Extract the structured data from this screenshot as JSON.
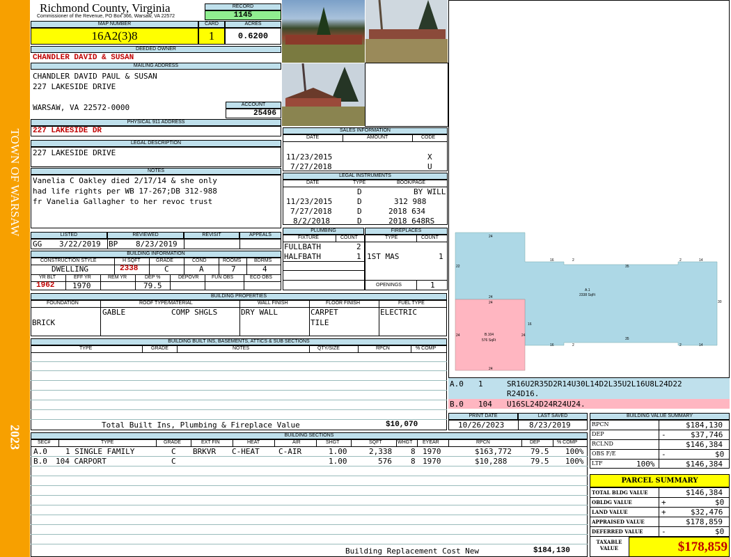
{
  "side": {
    "town": "TOWN OF WARSAW",
    "year": "2023"
  },
  "header": {
    "county": "Richmond County, Virginia",
    "commissioner": "Commissioner of the Revenue, PO Box 366, Warsaw, VA 22572",
    "record_label": "RECORD",
    "record": "1145",
    "map_label": "MAP NUMBER",
    "map": "16A2(3)8",
    "card_label": "CARD",
    "card": "1",
    "acres_label": "ACRES",
    "acres": "0.6200"
  },
  "owner": {
    "deeded_label": "DEEDED OWNER",
    "deeded": "CHANDLER DAVID & SUSAN",
    "mailing_label": "MAILING ADDRESS",
    "line1": "CHANDLER DAVID PAUL & SUSAN",
    "line2": "227 LAKESIDE DRIVE",
    "line3": "WARSAW, VA 22572-0000",
    "account_label": "ACCOUNT",
    "account": "25496"
  },
  "physical": {
    "label": "PHYSICAL 911 ADDRESS",
    "value": "227 LAKESIDE DR"
  },
  "legal": {
    "label": "LEGAL DESCRIPTION",
    "value": "227 LAKESIDE DRIVE"
  },
  "notes": {
    "label": "NOTES",
    "lines": [
      "Vanelia C Oakley died 2/17/14 & she only",
      "had life rights per WB 17-267;DB 312-988",
      "fr Vanelia Gallagher to her revoc trust"
    ]
  },
  "sales": {
    "label": "SALES INFORMATION",
    "cols": [
      "DATE",
      "AMOUNT",
      "CODE"
    ],
    "rows": [
      {
        "date": "11/23/2015",
        "code": "X"
      },
      {
        "date": "7/27/2018",
        "code": "U"
      }
    ]
  },
  "instruments": {
    "label": "LEGAL INSTRUMENTS",
    "cols": [
      "DATE",
      "TYPE",
      "BOOK/PAGE"
    ],
    "rows": [
      {
        "date": "",
        "type": "D",
        "book": "BY WILL"
      },
      {
        "date": "11/23/2015",
        "type": "D",
        "book": "312 988"
      },
      {
        "date": "7/27/2018",
        "type": "D",
        "book": "2018 634"
      },
      {
        "date": "8/2/2018",
        "type": "D",
        "book": "2018 648RS"
      }
    ]
  },
  "review": {
    "cols": [
      "LISTED",
      "REVIEWED",
      "REVISIT",
      "APPEALS"
    ],
    "listed_by": "GG",
    "listed": "3/22/2019",
    "reviewed_by": "BP",
    "reviewed": "8/23/2019"
  },
  "building": {
    "label": "BUILDING INFORMATION",
    "cols": [
      "CONSTRUCTION STYLE",
      "H SQFT",
      "GRADE",
      "COND",
      "ROOMS",
      "BDRMS"
    ],
    "style": "DWELLING",
    "sqft": "2338",
    "grade": "C",
    "cond": "A",
    "rooms": "7",
    "bdrms": "4",
    "cols2": [
      "YR BLT",
      "EFF YR",
      "REM YR",
      "DEP %",
      "DEPOVR",
      "FUN OBS",
      "ECO OBS"
    ],
    "yr": "1962",
    "eff": "1970",
    "dep": "79.5"
  },
  "plumbing": {
    "label": "PLUMBING",
    "cols": [
      "FIXTURE",
      "COUNT"
    ],
    "rows": [
      {
        "f": "FULLBATH",
        "c": "2"
      },
      {
        "f": "HALFBATH",
        "c": "1"
      }
    ]
  },
  "fireplaces": {
    "label": "FIREPLACES",
    "cols": [
      "TYPE",
      "COUNT"
    ],
    "rows": [
      {
        "t": "1ST MAS",
        "c": "1"
      }
    ],
    "openings_label": "OPENINGS",
    "openings": "1"
  },
  "properties": {
    "label": "BUILDING PROPERTIES",
    "cols": [
      "FOUNDATION",
      "ROOF TYPE/MATERIAL",
      "WALL FINISH",
      "FLOOR FINISH",
      "FUEL TYPE"
    ],
    "foundation": "BRICK",
    "roof1": "GABLE",
    "roof2": "COMP SHGLS",
    "wall": "DRY WALL",
    "floor1": "CARPET",
    "floor2": "TILE",
    "fuel": "ELECTRIC"
  },
  "builtins": {
    "label": "BUILDING BUILT INS, BASEMENTS, ATTICS & SUB SECTIONS",
    "cols": [
      "TYPE",
      "GRADE",
      "NOTES",
      "QTY/SIZE",
      "RPCN",
      "% COMP"
    ],
    "total_label": "Total Built Ins, Plumbing & Fireplace Value",
    "total": "$10,070"
  },
  "sketch": {
    "area_a": "2338 SqFt",
    "area_b": "576 SqFt",
    "label_a": "A.1",
    "label_b": "B.104",
    "d24": "24",
    "d16": "16",
    "d2": "2",
    "d35": "35",
    "d14": "14",
    "d22": "22",
    "d30": "30",
    "rows": [
      {
        "code": "A.0",
        "n": "1",
        "desc": "SR16U2R35D2R14U30L14D2L35U2L16U8L24D22",
        "desc2": "R24D16."
      },
      {
        "code": "B.0",
        "n": "104",
        "desc": "U16SL24D24R24U24."
      }
    ]
  },
  "dates": {
    "print_label": "PRINT DATE",
    "print": "10/26/2023",
    "saved_label": "LAST SAVED",
    "saved": "8/23/2019"
  },
  "sections": {
    "label": "BUILDING SECTIONS",
    "cols": [
      "SEC#",
      "TYPE",
      "GRADE",
      "EXT FIN",
      "HEAT",
      "AIR",
      "SHGT",
      "SQFT",
      "WHGT",
      "EYEAR",
      "RPCN",
      "DEP",
      "% COMP"
    ],
    "rows": [
      {
        "sec": "A.0",
        "type": "1 SINGLE FAMILY",
        "grade": "C",
        "ext": "BRKVR",
        "heat": "C-HEAT",
        "air": "C-AIR",
        "shgt": "1.00",
        "sqft": "2,338",
        "whgt": "8",
        "eyear": "1970",
        "rpcn": "$163,772",
        "dep": "79.5",
        "comp": "100%"
      },
      {
        "sec": "B.0",
        "type": "104 CARPORT",
        "grade": "C",
        "ext": "",
        "heat": "",
        "air": "",
        "shgt": "1.00",
        "sqft": "576",
        "whgt": "8",
        "eyear": "1970",
        "rpcn": "$10,288",
        "dep": "79.5",
        "comp": "100%"
      }
    ],
    "total_label": "Building Replacement Cost New",
    "total": "$184,130"
  },
  "bvs": {
    "label": "BUILDING VALUE SUMMARY",
    "rows": [
      {
        "l": "RPCN",
        "s": "",
        "v": "$184,130"
      },
      {
        "l": "DEP",
        "s": "-",
        "v": "$37,746"
      },
      {
        "l": "RCLND",
        "s": "",
        "v": "$146,384"
      },
      {
        "l": "OBS F/E",
        "s": "-",
        "v": "$0"
      },
      {
        "l": "LTF",
        "s": "100%",
        "v": "$146,384"
      }
    ]
  },
  "parcel": {
    "label": "PARCEL SUMMARY",
    "rows": [
      {
        "l": "TOTAL BLDG VALUE",
        "s": "",
        "v": "$146,384"
      },
      {
        "l": "OBLDG VALUE",
        "s": "+",
        "v": "$0"
      },
      {
        "l": "LAND VALUE",
        "s": "+",
        "v": "$32,476"
      },
      {
        "l": "APPRAISED VALUE",
        "s": "",
        "v": "$178,859"
      },
      {
        "l": "DEFERRED VALUE",
        "s": "-",
        "v": "$0"
      }
    ],
    "taxable_label1": "TAXABLE",
    "taxable_label2": "VALUE",
    "taxable": "$178,859"
  },
  "colors": {
    "side": "#f7a000",
    "yellow": "#ffff00",
    "green": "#90ee90",
    "cyan": "#bfe0ec",
    "pink": "#ffb6c1",
    "sketch_blue": "#a8d8e8"
  }
}
